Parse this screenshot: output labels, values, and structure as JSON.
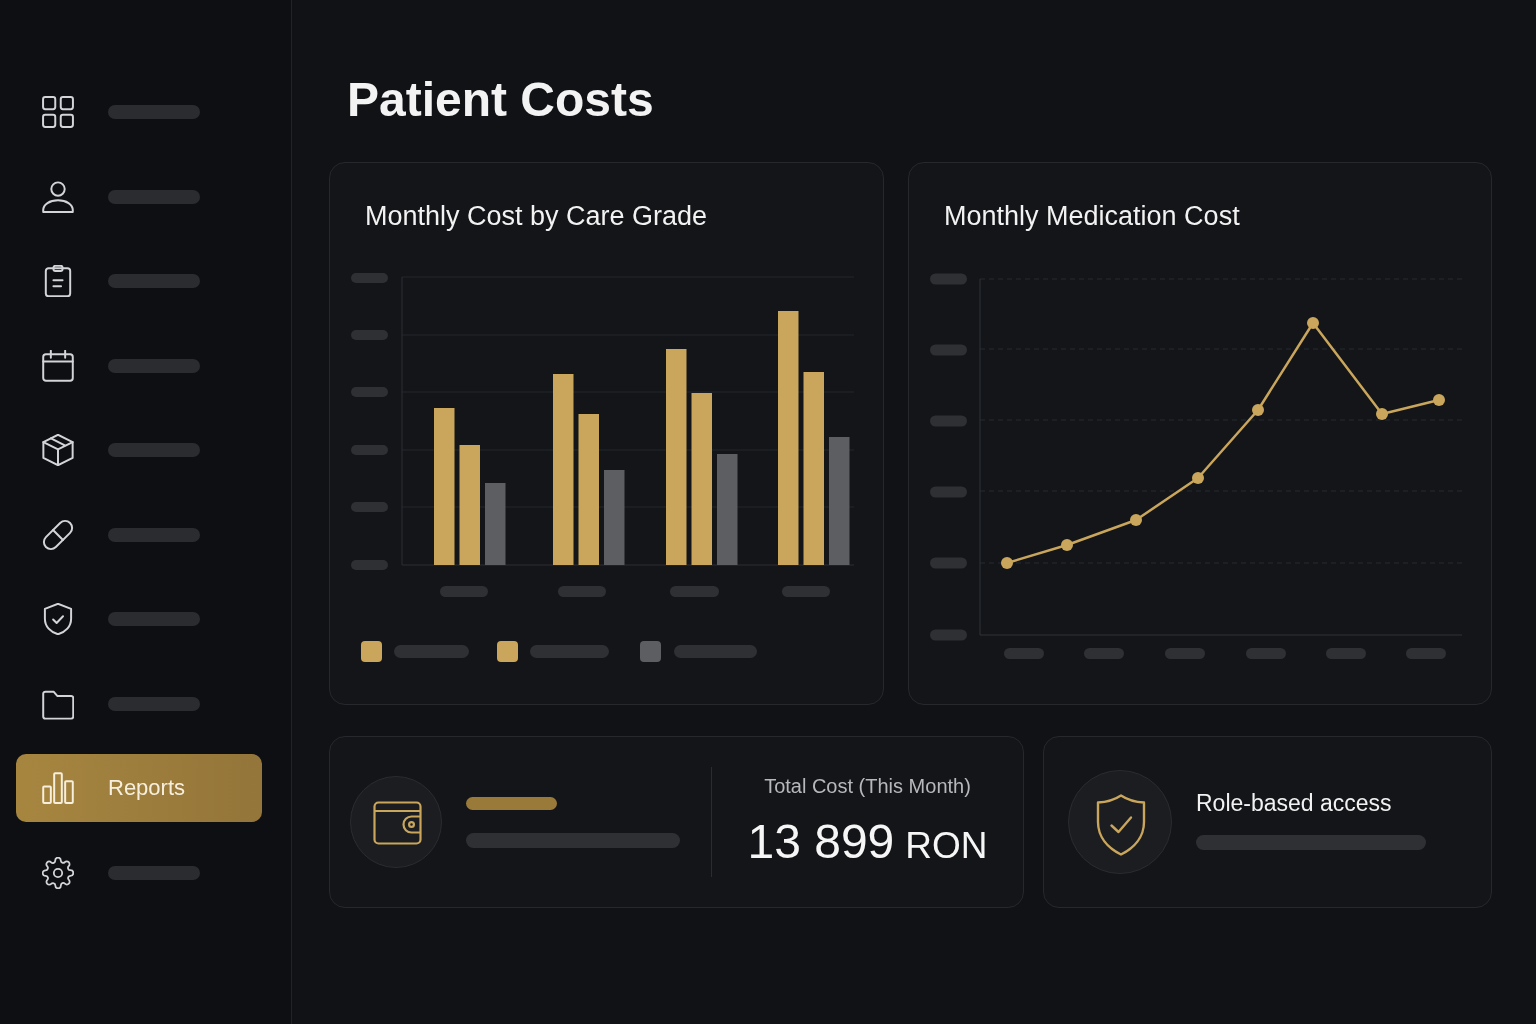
{
  "sidebar": {
    "items": [
      {
        "selected": false
      },
      {
        "selected": false
      },
      {
        "selected": false
      },
      {
        "selected": false
      },
      {
        "selected": false
      },
      {
        "selected": false
      },
      {
        "selected": false
      },
      {
        "selected": false
      },
      {
        "label": "Reports",
        "selected": true
      },
      {
        "selected": false
      }
    ]
  },
  "page_title": "Patient Costs",
  "charts": [
    {
      "kind": "bar",
      "title": "Monthly Cost by Care Grade"
    },
    {
      "kind": "line",
      "title": "Monthly Medication Cost"
    }
  ],
  "summary_cards": [
    {
      "kind": "stat",
      "label": "Total Cost (This Month)",
      "value": "13 899",
      "unit": "RON"
    },
    {
      "kind": "feature",
      "title": "Role-based access"
    }
  ]
}
